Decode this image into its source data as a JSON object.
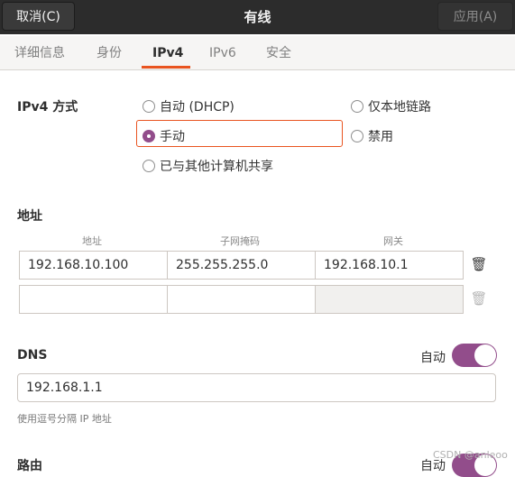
{
  "header": {
    "cancel_label": "取消(C)",
    "title": "有线",
    "apply_label": "应用(A)"
  },
  "tabs": [
    {
      "label": "详细信息"
    },
    {
      "label": "身份"
    },
    {
      "label": "IPv4"
    },
    {
      "label": "IPv6"
    },
    {
      "label": "安全"
    }
  ],
  "ipv4": {
    "method_label": "IPv4 方式",
    "options": {
      "auto": "自动 (DHCP)",
      "link_local": "仅本地链路",
      "manual": "手动",
      "disable": "禁用",
      "shared": "已与其他计算机共享"
    },
    "selected": "manual"
  },
  "address": {
    "section_label": "地址",
    "col_address": "地址",
    "col_netmask": "子网掩码",
    "col_gateway": "网关",
    "rows": [
      {
        "address": "192.168.10.100",
        "netmask": "255.255.255.0",
        "gateway": "192.168.10.1"
      },
      {
        "address": "",
        "netmask": "",
        "gateway": ""
      }
    ],
    "delete_icon": "trash-icon"
  },
  "dns": {
    "label": "DNS",
    "auto_label": "自动",
    "auto_on": true,
    "value": "192.168.1.1",
    "hint": "使用逗号分隔 IP 地址"
  },
  "routes": {
    "label": "路由",
    "auto_label": "自动",
    "auto_on": true
  },
  "watermark": "CSDN @anleoo",
  "colors": {
    "accent": "#e95420",
    "toggle_on": "#924d8b",
    "header_bg": "#2c2c2c"
  }
}
